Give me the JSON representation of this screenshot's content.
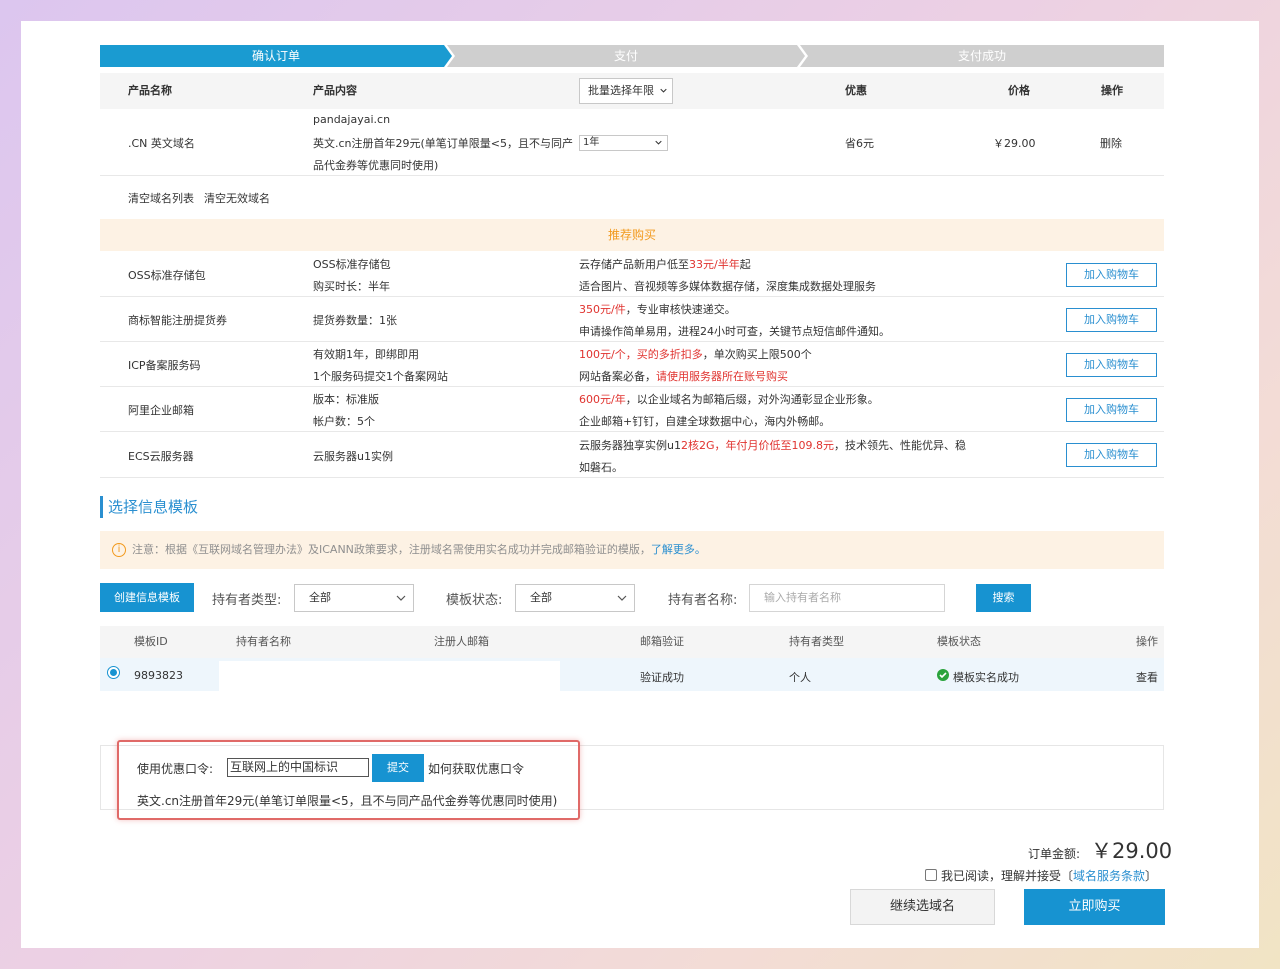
{
  "steps": [
    "确认订单",
    "支付",
    "支付成功"
  ],
  "order_table": {
    "headers": {
      "product_name": "产品名称",
      "product_content": "产品内容",
      "bulk_year_select": "批量选择年限",
      "discount": "优惠",
      "price": "价格",
      "action": "操作"
    },
    "row": {
      "product_name": ".CN 英文域名",
      "domain": "pandajayai.cn",
      "promo_line1": "英文.cn注册首年29元(单笔订单限量<5，且不与同产",
      "promo_line2": "品代金券等优惠同时使用)",
      "year": "1年",
      "discount": "省6元",
      "price": "￥29.00",
      "delete": "删除"
    },
    "clear_list": "清空域名列表",
    "clear_invalid": "清空无效域名"
  },
  "recommend": {
    "title": "推荐购买",
    "add_to_cart": "加入购物车",
    "items": [
      {
        "name": "OSS标准存储包",
        "c1": "OSS标准存储包",
        "c2": "购买时长：半年",
        "d1a": "云存储产品新用户低至",
        "d1b": "33元/半年",
        "d1c": "起",
        "d2a": "适合图片、音视频等多媒体数据存储，深度集成数据处理服务",
        "d2b": ""
      },
      {
        "name": "商标智能注册提货券",
        "c1": "提货券数量：1张",
        "c2": "",
        "d1a": "",
        "d1b": "350元/件",
        "d1c": "，专业审核快速递交。",
        "d2a": "申请操作简单易用，进程24小时可查，关键节点短信邮件通知。",
        "d2b": ""
      },
      {
        "name": "ICP备案服务码",
        "c1": "有效期1年，即绑即用",
        "c2": "1个服务码提交1个备案网站",
        "d1a": "",
        "d1b": "100元/个，买的多折扣多",
        "d1c": "，单次购买上限500个",
        "d2a": "网站备案必备，",
        "d2b": "请使用服务器所在账号购买"
      },
      {
        "name": "阿里企业邮箱",
        "c1": "版本：标准版",
        "c2": "帐户数：5个",
        "d1a": "",
        "d1b": "600元/年",
        "d1c": "，以企业域名为邮箱后缀，对外沟通彰显企业形象。",
        "d2a": "企业邮箱+钉钉，自建全球数据中心，海内外畅邮。",
        "d2b": ""
      },
      {
        "name": "ECS云服务器",
        "c1": "云服务器u1实例",
        "c2": "",
        "d1a": "云服务器独享实例u1",
        "d1b": "2核2G，年付月价低至109.8元",
        "d1c": "，技术领先、性能优异、稳",
        "d2a": "如磐石。",
        "d2b": ""
      }
    ]
  },
  "template": {
    "section_title": "选择信息模板",
    "notice_text": "注意：根据《互联网域名管理办法》及ICANN政策要求，注册域名需使用实名成功并完成邮箱验证的模版，",
    "notice_link": "了解更多。",
    "create_button": "创建信息模板",
    "holder_type_label": "持有者类型:",
    "holder_type_value": "全部",
    "status_label": "模板状态:",
    "status_value": "全部",
    "holder_name_label": "持有者名称:",
    "holder_name_placeholder": "输入持有者名称",
    "search_button": "搜索",
    "headers": [
      "模板ID",
      "持有者名称",
      "注册人邮箱",
      "邮箱验证",
      "持有者类型",
      "模板状态",
      "操作"
    ],
    "row": {
      "id": "9893823",
      "email_verify": "验证成功",
      "holder_type": "个人",
      "status": "模板实名成功",
      "action": "查看"
    }
  },
  "coupon": {
    "label": "使用优惠口令:",
    "value": "互联网上的中国标识",
    "submit": "提交",
    "how_link": "如何获取优惠口令",
    "success_msg": "英文.cn注册首年29元(单笔订单限量<5，且不与同产品代金券等优惠同时使用)"
  },
  "summary": {
    "amount_label": "订单金额:",
    "amount": "￥29.00",
    "agree_text": "我已阅读，理解并接受〔",
    "agree_link": "域名服务条款",
    "agree_close": "〕",
    "continue_button": "继续选域名",
    "buy_button": "立即购买"
  },
  "colors": {
    "accent": "#1793d1",
    "link": "#2a8fd0",
    "warning": "#f29a1e",
    "error": "#e0332f",
    "success": "#2aa33c"
  }
}
